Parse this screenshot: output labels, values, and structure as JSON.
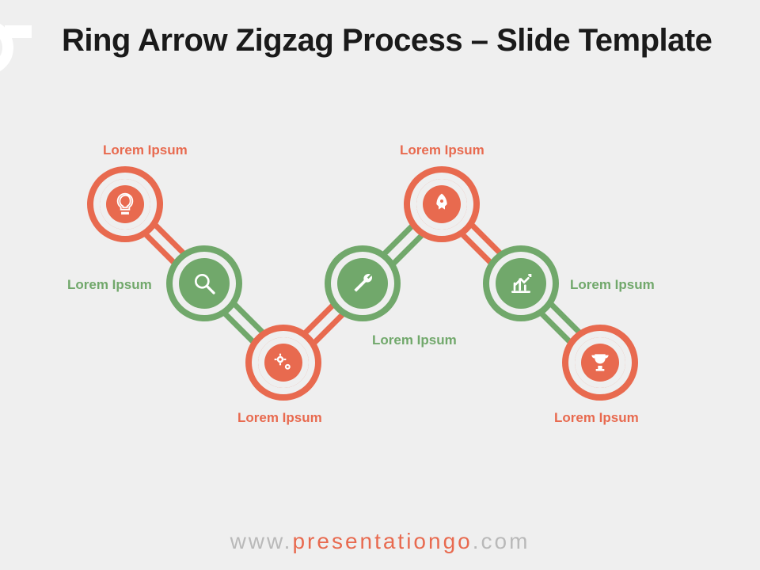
{
  "title": "Ring Arrow Zigzag Process – Slide Template",
  "colors": {
    "orange": "#e86a4f",
    "green": "#71a86b",
    "bg": "#efefef"
  },
  "nodes": [
    {
      "id": "n1",
      "color": "orange",
      "icon": "lightbulb-icon",
      "label": "Lorem Ipsum",
      "label_pos": "top-right"
    },
    {
      "id": "n2",
      "color": "green",
      "icon": "magnifier-icon",
      "label": "Lorem Ipsum",
      "label_pos": "left"
    },
    {
      "id": "n3",
      "color": "orange",
      "icon": "gears-icon",
      "label": "Lorem Ipsum",
      "label_pos": "bottom"
    },
    {
      "id": "n4",
      "color": "green",
      "icon": "wrench-icon",
      "label": "Lorem Ipsum",
      "label_pos": "bottom"
    },
    {
      "id": "n5",
      "color": "orange",
      "icon": "rocket-icon",
      "label": "Lorem Ipsum",
      "label_pos": "top"
    },
    {
      "id": "n6",
      "color": "green",
      "icon": "chart-icon",
      "label": "Lorem Ipsum",
      "label_pos": "right"
    },
    {
      "id": "n7",
      "color": "orange",
      "icon": "trophy-icon",
      "label": "Lorem Ipsum",
      "label_pos": "bottom"
    }
  ],
  "footer": {
    "pre": "www.",
    "mid": "presentationgo",
    "post": ".com"
  }
}
